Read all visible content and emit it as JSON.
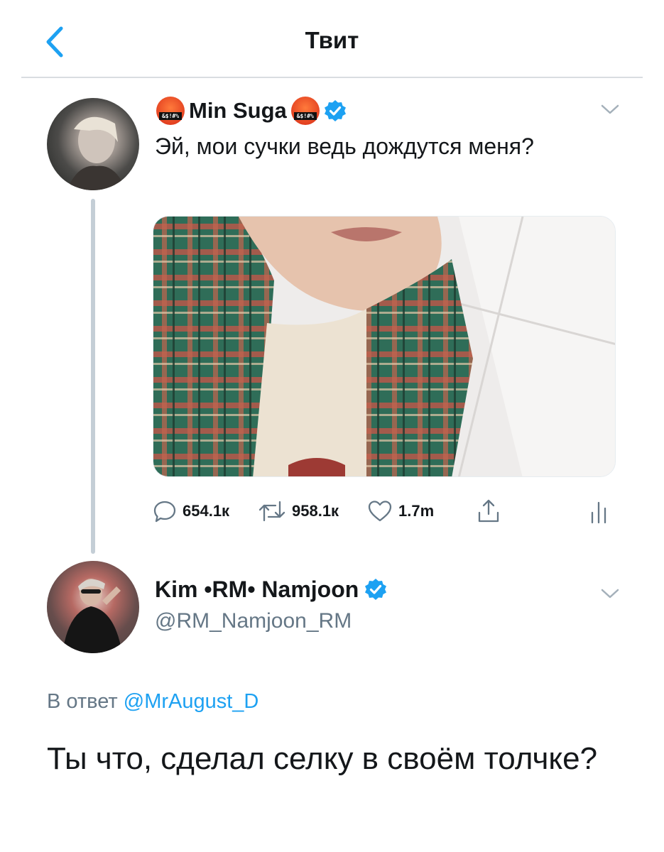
{
  "header": {
    "title": "Твит"
  },
  "tweet1": {
    "author_name": "Min Suga",
    "emoji_caption": "&$!#%",
    "text": "Эй, мои сучки ведь дождутся меня?",
    "stats": {
      "replies": "654.1к",
      "retweets": "958.1к",
      "likes": "1.7m"
    }
  },
  "tweet2": {
    "author_name": "Kim •RM• Namjoon",
    "handle": "@RM_Namjoon_RM",
    "reply_prefix": "В ответ",
    "reply_to": "@MrAugust_D",
    "text": "Ты что, сделал селку в своём толчке?"
  },
  "icons": {
    "back": "chevron-left-icon",
    "verified": "verified-badge-icon",
    "more": "chevron-down-icon",
    "reply": "comment-icon",
    "retweet": "retweet-icon",
    "like": "heart-icon",
    "share": "share-icon",
    "analytics": "analytics-icon"
  },
  "colors": {
    "accent": "#1da1f2",
    "secondary_text": "#657786",
    "thread_line": "#c4ced6"
  }
}
